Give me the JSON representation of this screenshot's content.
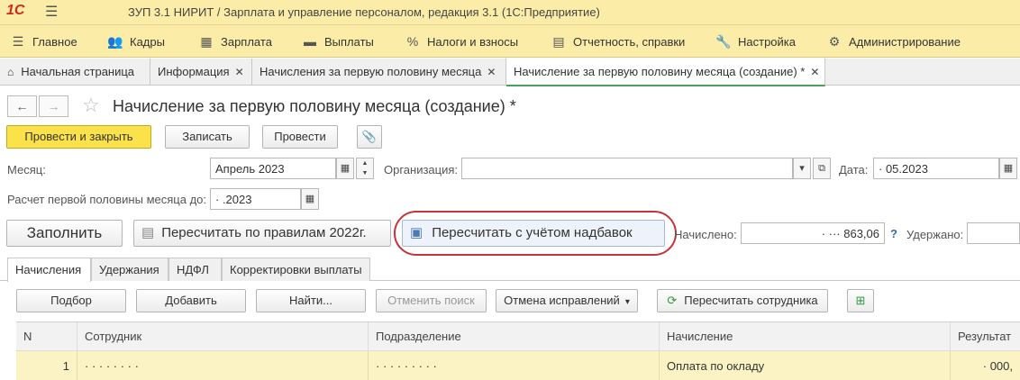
{
  "app": {
    "logo": "1С",
    "title": "ЗУП 3.1 НИРИТ / Зарплата и управление персоналом, редакция 3.1  (1С:Предприятие)"
  },
  "menu": [
    {
      "label": "Главное",
      "icon": "menu-icon"
    },
    {
      "label": "Кадры",
      "icon": "people-icon"
    },
    {
      "label": "Зарплата",
      "icon": "calculator-icon"
    },
    {
      "label": "Выплаты",
      "icon": "wallet-icon"
    },
    {
      "label": "Налоги и взносы",
      "icon": "percent-icon"
    },
    {
      "label": "Отчетность, справки",
      "icon": "report-icon"
    },
    {
      "label": "Настройка",
      "icon": "wrench-icon"
    },
    {
      "label": "Администрирование",
      "icon": "gear-icon"
    }
  ],
  "tabs": [
    {
      "label": "Начальная страница"
    },
    {
      "label": "Информация"
    },
    {
      "label": "Начисления за первую половину месяца"
    },
    {
      "label": "Начисление за первую половину месяца (создание) *"
    }
  ],
  "doc": {
    "title": "Начисление за первую половину месяца (создание) *"
  },
  "toolbar": {
    "post_close": "Провести и закрыть",
    "save": "Записать",
    "post": "Провести"
  },
  "form": {
    "month_label": "Месяц:",
    "month_value": "Апрель 2023",
    "org_label": "Организация:",
    "org_value": "",
    "date_label": "Дата:",
    "date_value": "·  05.2023",
    "calc_label": "Расчет первой половины месяца до:",
    "calc_value": "·  .2023"
  },
  "actions": {
    "fill": "Заполнить",
    "recalc_rules": "Пересчитать по правилам 2022г.",
    "recalc_bonus": "Пересчитать с учётом надбавок",
    "accrued_label": "Начислено:",
    "accrued_value": "· ··· 863,06",
    "help": "?",
    "withheld_label": "Удержано:"
  },
  "subtabs": [
    {
      "label": "Начисления"
    },
    {
      "label": "Удержания"
    },
    {
      "label": "НДФЛ"
    },
    {
      "label": "Корректировки выплаты"
    }
  ],
  "table_toolbar": {
    "pick": "Подбор",
    "add": "Добавить",
    "find": "Найти...",
    "cancel_search": "Отменить поиск",
    "cancel_fixes": "Отмена исправлений",
    "recalc_emp": "Пересчитать сотрудника"
  },
  "table": {
    "columns": [
      "N",
      "Сотрудник",
      "Подразделение",
      "Начисление",
      "Результат"
    ],
    "rows": [
      {
        "n": "1",
        "employee": "· ·   ·  ·  ·  · · ·",
        "dept": "·  ·  ·  ·  ·  ·  · · ·",
        "accrual": "Оплата по окладу",
        "result": "· 000,"
      }
    ]
  }
}
